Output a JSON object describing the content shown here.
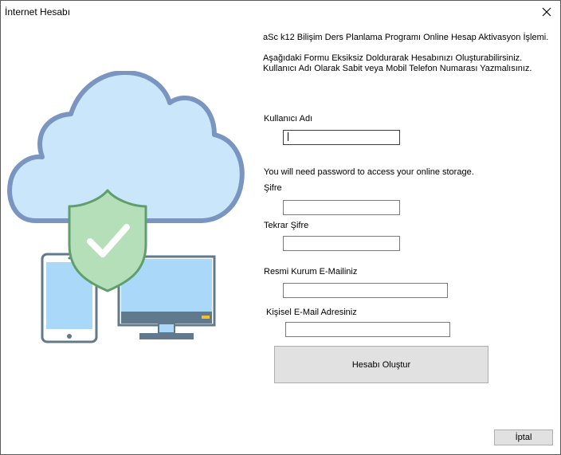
{
  "window": {
    "title": "İnternet Hesabı"
  },
  "intro": {
    "heading": "aSc k12 Bilişim Ders Planlama Programı Online Hesap Aktivasyon İşlemi.",
    "line1": "Aşağıdaki Formu Eksiksiz Doldurarak Hesabınızı Oluşturabilirsiniz.",
    "line2": "Kullanıcı Adı Olarak Sabit veya Mobil Telefon Numarası Yazmalısınız."
  },
  "form": {
    "username_label": "Kullanıcı Adı",
    "username_value": "",
    "password_note": "You will need password to access your online storage.",
    "password_label": "Şifre",
    "password_value": "",
    "password_repeat_label": "Tekrar Şifre",
    "password_repeat_value": "",
    "institution_email_label": "Resmi Kurum E-Mailiniz",
    "institution_email_value": "",
    "personal_email_label": "Kişisel E-Mail Adresiniz",
    "personal_email_value": ""
  },
  "buttons": {
    "create": "Hesabı Oluştur",
    "cancel": "İptal"
  },
  "icons": {
    "close": "close-icon",
    "illustration": "cloud-security-illustration"
  },
  "colors": {
    "cloud_fill": "#c9e6fb",
    "cloud_stroke": "#7a95c0",
    "shield_fill": "#b5dfb8",
    "shield_stroke": "#5f9f6c",
    "device_stroke": "#61798c",
    "screen_fill": "#a9d8f8",
    "accent_led": "#f2c02a"
  }
}
